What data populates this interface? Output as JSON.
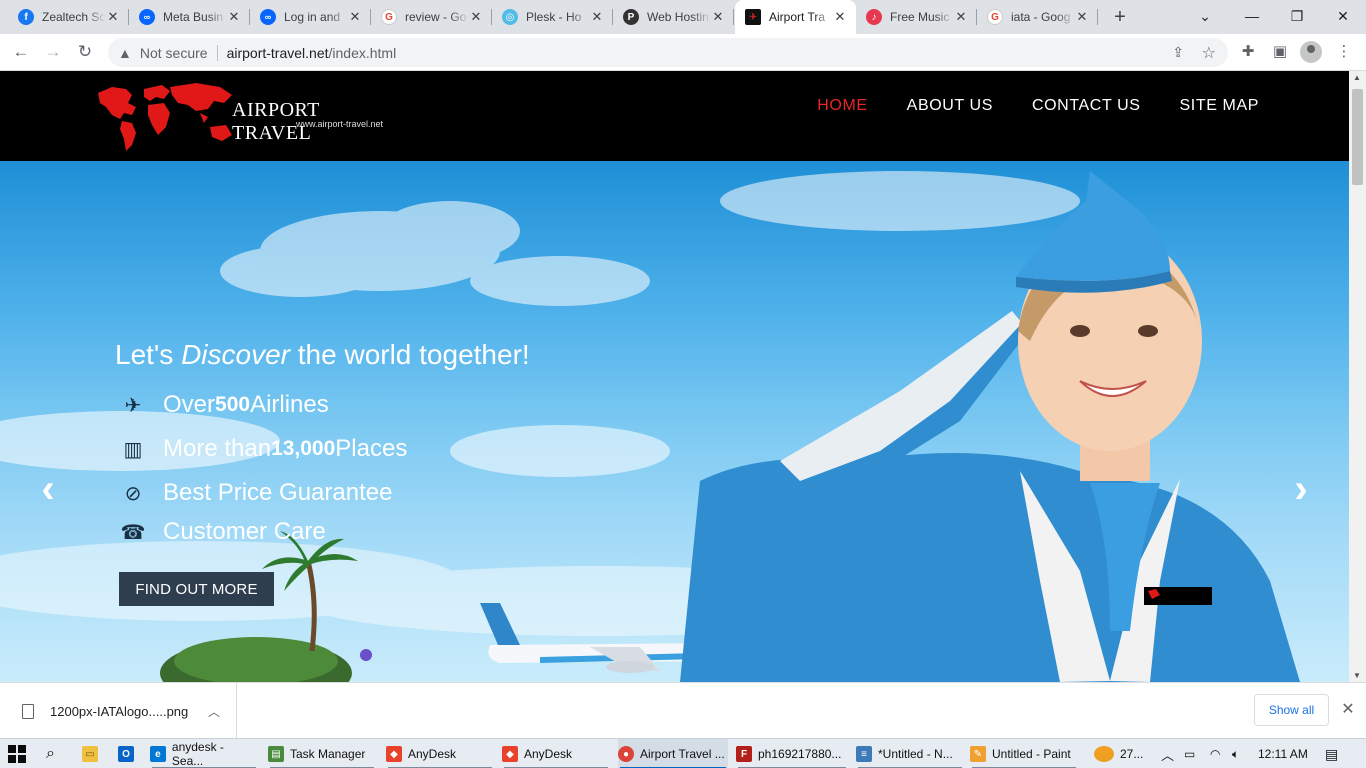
{
  "browser": {
    "tabs": [
      {
        "title": "Zealtech Sc",
        "fav_color": "#1877f2",
        "fav_glyph": "f",
        "icon": "facebook-icon"
      },
      {
        "title": "Meta Busin",
        "fav_color": "#0866ff",
        "fav_glyph": "∞",
        "icon": "meta-icon"
      },
      {
        "title": "Log in and",
        "fav_color": "#0866ff",
        "fav_glyph": "∞",
        "icon": "meta-icon"
      },
      {
        "title": "review - Go",
        "fav_color": "#ea4335",
        "fav_glyph": "G",
        "icon": "google-icon"
      },
      {
        "title": "Plesk - Ho",
        "fav_color": "#52bbe6",
        "fav_glyph": "◎",
        "icon": "plesk-icon"
      },
      {
        "title": "Web Hostin",
        "fav_color": "#333333",
        "fav_glyph": "P",
        "icon": "web-hosting-icon"
      },
      {
        "title": "Airport Tra",
        "fav_color": "#111111",
        "fav_glyph": "✈",
        "icon": "airport-travel-icon",
        "active": true
      },
      {
        "title": "Free Music",
        "fav_color": "#e63950",
        "fav_glyph": "♪",
        "icon": "music-icon"
      },
      {
        "title": "iata - Goog",
        "fav_color": "#ea4335",
        "fav_glyph": "G",
        "icon": "google-icon"
      }
    ],
    "new_tab": "+",
    "security_label": "Not secure",
    "url_host": "airport-travel.net",
    "url_path": "/index.html"
  },
  "site": {
    "brand": "AIRPORT TRAVEL",
    "brand_url": "www.airport-travel.net",
    "nav": [
      {
        "label": "HOME",
        "active": true
      },
      {
        "label": "ABOUT US"
      },
      {
        "label": "CONTACT US"
      },
      {
        "label": "SITE MAP"
      }
    ],
    "hero": {
      "headline_pre": "Let's ",
      "headline_em": "Discover",
      "headline_post": " the world together!",
      "features": [
        {
          "pre": "Over ",
          "num": "500",
          "post": " Airlines",
          "icon": "airplane-icon"
        },
        {
          "pre": "More than ",
          "num": "13,000",
          "post": " Places",
          "icon": "city-icon"
        },
        {
          "pre": "Best Price Guarantee",
          "num": "",
          "post": "",
          "icon": "check-circle-icon"
        },
        {
          "pre": "Customer Care",
          "num": "",
          "post": "",
          "icon": "support-agent-icon"
        }
      ],
      "cta": "FIND OUT MORE",
      "badge": "AIRPORT TRAVEL"
    }
  },
  "downloads": {
    "file_name": "1200px-IATAlogo.....png",
    "show_all": "Show all"
  },
  "taskbar": {
    "items": [
      {
        "label": "anydesk - Sea...",
        "color": "#0078d4",
        "glyph": "e"
      },
      {
        "label": "Task Manager",
        "color": "#4a8a3c",
        "glyph": "▤"
      },
      {
        "label": "AnyDesk",
        "color": "#e8412c",
        "glyph": "◆"
      },
      {
        "label": "AnyDesk",
        "color": "#e8412c",
        "glyph": "◆"
      },
      {
        "label": "Airport Travel ...",
        "color": "#db4437",
        "glyph": "●"
      },
      {
        "label": "ph169217880...",
        "color": "#b3201a",
        "glyph": "F"
      },
      {
        "label": "*Untitled - N...",
        "color": "#3d7ab8",
        "glyph": "≡"
      },
      {
        "label": "Untitled - Paint",
        "color": "#f0a030",
        "glyph": "✎"
      }
    ],
    "weather": "27...",
    "time": "12:11 AM"
  }
}
